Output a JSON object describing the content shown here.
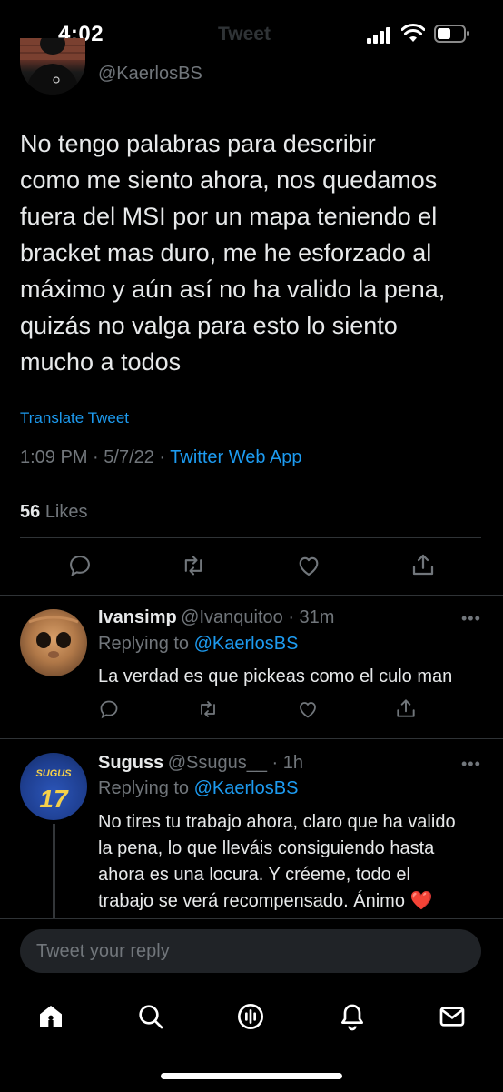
{
  "status_bar": {
    "time": "4:02",
    "ghost_title": "Tweet"
  },
  "tweet": {
    "handle": "@KaerlosBS",
    "text": "No tengo palabras para describir\ncomo me siento ahora, nos quedamos\nfuera del MSI por un mapa teniendo el\nbracket mas duro, me he esforzado al\nmáximo y aún así no ha valido la pena,\nquizás no valga para esto lo siento\nmucho a todos",
    "translate": "Translate Tweet",
    "time": "1:09 PM",
    "date": "5/7/22",
    "app": "Twitter Web App",
    "likes_count": "56",
    "likes_label": "Likes"
  },
  "replies": [
    {
      "name": "Ivansimp",
      "handle": "@Ivanquitoo",
      "age": "31m",
      "replying_to_label": "Replying to",
      "replying_to": "@KaerlosBS",
      "text": "La verdad es que pickeas como el culo man"
    },
    {
      "name": "Suguss",
      "handle": "@Ssugus__",
      "age": "1h",
      "replying_to_label": "Replying to",
      "replying_to": "@KaerlosBS",
      "avatar_text": "SUGUS",
      "avatar_number": "17",
      "text": "No tires tu trabajo ahora, claro que ha valido\nla pena, lo que lleváis consiguiendo hasta\nahora es una locura. Y créeme, todo el\ntrabajo se verá recompensado. Ánimo ❤️"
    }
  ],
  "reply_bar": {
    "placeholder": "Tweet your reply"
  },
  "tab_bar": [
    "home-icon",
    "search-icon",
    "spaces-icon",
    "notifications-icon",
    "messages-icon"
  ],
  "colors": {
    "accent": "#1d9bf0",
    "background": "#000000",
    "muted": "#71767b",
    "divider": "#2f3336"
  }
}
